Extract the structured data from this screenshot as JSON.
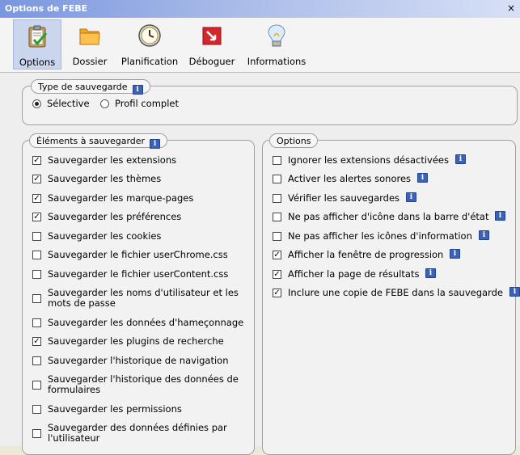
{
  "window": {
    "title": "Options de FEBE",
    "close_glyph": "×"
  },
  "toolbar": {
    "items": [
      {
        "label": "Options",
        "icon": "options-clipboard-icon"
      },
      {
        "label": "Dossier",
        "icon": "folder-icon"
      },
      {
        "label": "Planification",
        "icon": "clock-icon"
      },
      {
        "label": "Déboguer",
        "icon": "debug-icon"
      },
      {
        "label": "Informations",
        "icon": "lightbulb-icon"
      }
    ],
    "selected": "Options"
  },
  "backup_type": {
    "legend": "Type de sauvegarde",
    "options": [
      {
        "label": "Sélective",
        "selected": true
      },
      {
        "label": "Profil complet",
        "selected": false
      }
    ]
  },
  "elements": {
    "legend": "Éléments à sauvegarder",
    "items": [
      {
        "label": "Sauvegarder les extensions",
        "checked": true
      },
      {
        "label": "Sauvegarder les thèmes",
        "checked": true
      },
      {
        "label": "Sauvegarder les marque-pages",
        "checked": true
      },
      {
        "label": "Sauvegarder les préférences",
        "checked": true
      },
      {
        "label": "Sauvegarder les cookies",
        "checked": false
      },
      {
        "label": "Sauvegarder le fichier userChrome.css",
        "checked": false
      },
      {
        "label": "Sauvegarder le fichier userContent.css",
        "checked": false
      },
      {
        "label": "Sauvegarder les noms d'utilisateur et les mots de passe",
        "checked": false
      },
      {
        "label": "Sauvegarder les données d'hameçonnage",
        "checked": false
      },
      {
        "label": "Sauvegarder les plugins de recherche",
        "checked": true
      },
      {
        "label": "Sauvegarder l'historique de navigation",
        "checked": false
      },
      {
        "label": "Sauvegarder l'historique des données de formulaires",
        "checked": false
      },
      {
        "label": "Sauvegarder les permissions",
        "checked": false
      },
      {
        "label": "Sauvegarder des données définies par l'utilisateur",
        "checked": false
      }
    ]
  },
  "options": {
    "legend": "Options",
    "items": [
      {
        "label": "Ignorer les extensions désactivées",
        "checked": false
      },
      {
        "label": "Activer les alertes sonores",
        "checked": false
      },
      {
        "label": "Vérifier les sauvegardes",
        "checked": false
      },
      {
        "label": "Ne pas afficher d'icône dans la barre d'état",
        "checked": false
      },
      {
        "label": "Ne pas afficher les icônes d'information",
        "checked": false
      },
      {
        "label": "Afficher la fenêtre de progression",
        "checked": true
      },
      {
        "label": "Afficher la page de résultats",
        "checked": true
      },
      {
        "label": "Inclure une copie de FEBE dans la sauvegarde",
        "checked": true
      }
    ]
  },
  "info_glyph": "i",
  "check_glyph": "✓"
}
